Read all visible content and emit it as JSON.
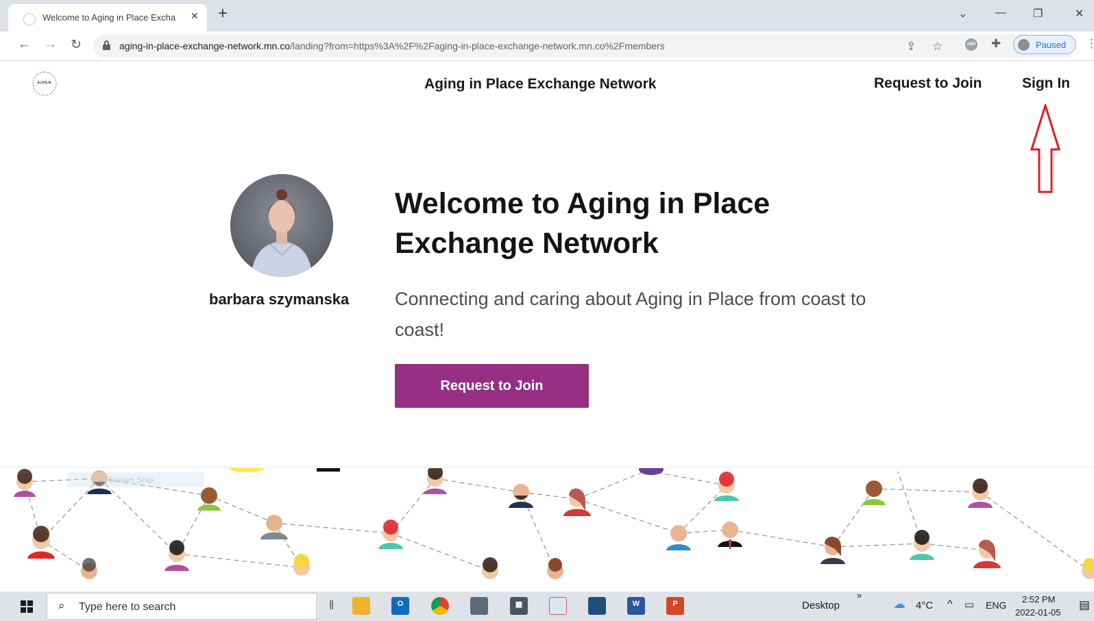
{
  "browser": {
    "tab_title": "Welcome to Aging in Place Excha",
    "tab_close_glyph": "✕",
    "new_tab_glyph": "+",
    "url_host": "aging-in-place-exchange-network.mn.co",
    "url_path": "/landing?from=https%3A%2F%2Faging-in-place-exchange-network.mn.co%2Fmembers",
    "profile_status": "Paused",
    "extension_badge": "ABP",
    "icons": [
      "back-icon",
      "forward-icon",
      "reload-icon",
      "lock-icon",
      "share-icon",
      "star-icon",
      "adblock-icon",
      "extensions-icon",
      "profile-icon",
      "more-icon"
    ]
  },
  "site": {
    "logo_text": "A.I.P.E.N.",
    "title": "Aging in Place Exchange Network",
    "nav": {
      "request_to_join": "Request to Join",
      "sign_in": "Sign In"
    }
  },
  "hero": {
    "owner_name": "barbara szymanska",
    "heading": "Welcome to Aging in Place Exchange Network",
    "subheading": "Connecting and caring about Aging in Place from coast to coast!",
    "cta_label": "Request to Join",
    "accent_color": "#962f84"
  },
  "banner": {
    "overlay_text": "Screen Snip"
  },
  "taskbar": {
    "search_placeholder": "Type here to search",
    "desktop_label": "Desktop",
    "overflow_glyph": "»",
    "temperature": "4°C",
    "language": "ENG",
    "time": "2:52 PM",
    "date": "2022-01-05",
    "apps": [
      "file-explorer-icon",
      "outlook-icon",
      "chrome-icon",
      "camera-icon",
      "calculator-icon",
      "snipping-tool-icon",
      "remote-desktop-icon",
      "word-icon",
      "powerpoint-icon"
    ]
  },
  "annotation": {
    "color": "#e01e1e"
  }
}
